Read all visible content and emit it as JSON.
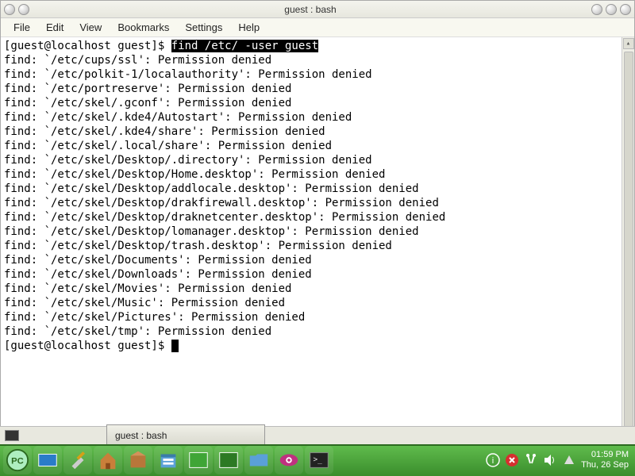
{
  "window": {
    "title": "guest : bash"
  },
  "menubar": [
    "File",
    "Edit",
    "View",
    "Bookmarks",
    "Settings",
    "Help"
  ],
  "terminal": {
    "prompt": "[guest@localhost guest]$ ",
    "highlighted_command": "find /etc/ -user guest",
    "lines": [
      "find: `/etc/cups/ssl': Permission denied",
      "find: `/etc/polkit-1/localauthority': Permission denied",
      "find: `/etc/portreserve': Permission denied",
      "find: `/etc/skel/.gconf': Permission denied",
      "find: `/etc/skel/.kde4/Autostart': Permission denied",
      "find: `/etc/skel/.kde4/share': Permission denied",
      "find: `/etc/skel/.local/share': Permission denied",
      "find: `/etc/skel/Desktop/.directory': Permission denied",
      "find: `/etc/skel/Desktop/Home.desktop': Permission denied",
      "find: `/etc/skel/Desktop/addlocale.desktop': Permission denied",
      "find: `/etc/skel/Desktop/drakfirewall.desktop': Permission denied",
      "find: `/etc/skel/Desktop/draknetcenter.desktop': Permission denied",
      "find: `/etc/skel/Desktop/lomanager.desktop': Permission denied",
      "find: `/etc/skel/Desktop/trash.desktop': Permission denied",
      "find: `/etc/skel/Documents': Permission denied",
      "find: `/etc/skel/Downloads': Permission denied",
      "find: `/etc/skel/Movies': Permission denied",
      "find: `/etc/skel/Music': Permission denied",
      "find: `/etc/skel/Pictures': Permission denied",
      "find: `/etc/skel/tmp': Permission denied"
    ],
    "prompt2": "[guest@localhost guest]$ "
  },
  "taskbar": {
    "button_label": "guest : bash"
  },
  "clock": {
    "time": "01:59 PM",
    "date": "Thu, 26 Sep"
  }
}
